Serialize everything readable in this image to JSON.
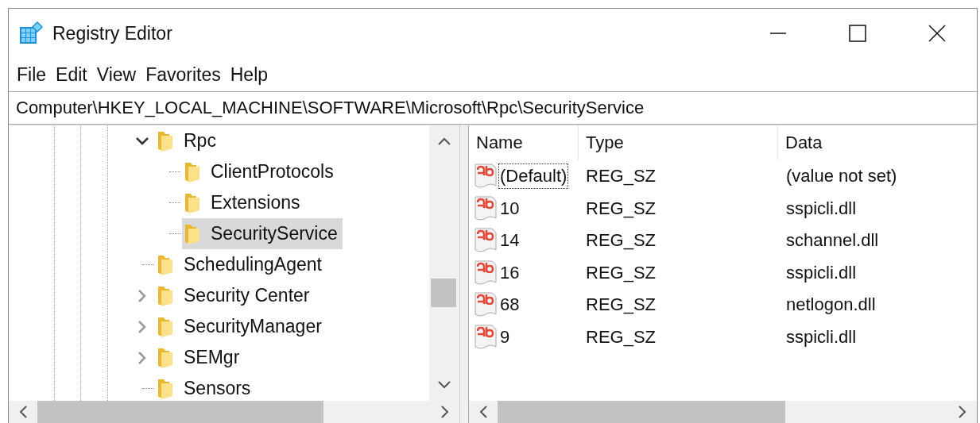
{
  "window": {
    "title": "Registry Editor"
  },
  "menu": [
    {
      "label": "File"
    },
    {
      "label": "Edit"
    },
    {
      "label": "View"
    },
    {
      "label": "Favorites"
    },
    {
      "label": "Help"
    }
  ],
  "address": {
    "value": "Computer\\HKEY_LOCAL_MACHINE\\SOFTWARE\\Microsoft\\Rpc\\SecurityService"
  },
  "tree": {
    "items": [
      {
        "label": "Rpc",
        "kind": "branch",
        "expanded": true,
        "selected": false,
        "children": [
          {
            "label": "ClientProtocols",
            "kind": "leaf",
            "selected": false
          },
          {
            "label": "Extensions",
            "kind": "leaf",
            "selected": false
          },
          {
            "label": "SecurityService",
            "kind": "leaf",
            "selected": true
          }
        ]
      },
      {
        "label": "SchedulingAgent",
        "kind": "leaf",
        "selected": false
      },
      {
        "label": "Security Center",
        "kind": "branch",
        "expanded": false,
        "selected": false
      },
      {
        "label": "SecurityManager",
        "kind": "branch",
        "expanded": false,
        "selected": false
      },
      {
        "label": "SEMgr",
        "kind": "branch",
        "expanded": false,
        "selected": false
      },
      {
        "label": "Sensors",
        "kind": "leaf",
        "selected": false
      }
    ]
  },
  "table": {
    "columns": [
      "Name",
      "Type",
      "Data"
    ],
    "rows": [
      {
        "name": "(Default)",
        "type": "REG_SZ",
        "data": "(value not set)",
        "focused": true
      },
      {
        "name": "10",
        "type": "REG_SZ",
        "data": "sspicli.dll",
        "focused": false
      },
      {
        "name": "14",
        "type": "REG_SZ",
        "data": "schannel.dll",
        "focused": false
      },
      {
        "name": "16",
        "type": "REG_SZ",
        "data": "sspicli.dll",
        "focused": false
      },
      {
        "name": "68",
        "type": "REG_SZ",
        "data": "netlogon.dll",
        "focused": false
      },
      {
        "name": "9",
        "type": "REG_SZ",
        "data": "sspicli.dll",
        "focused": false
      }
    ]
  }
}
